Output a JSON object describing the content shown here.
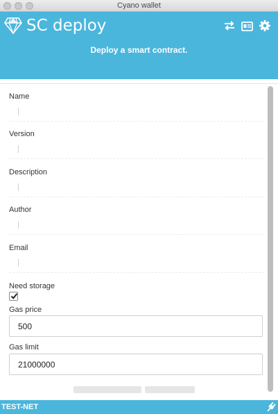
{
  "window": {
    "title": "Cyano wallet"
  },
  "header": {
    "app_title": "SC deploy",
    "subtitle": "Deploy a smart contract.",
    "icons": [
      "diamond-logo-icon",
      "swap-arrows-icon",
      "id-card-icon",
      "gear-icon"
    ]
  },
  "form": {
    "name_label": "Name",
    "name_value": "",
    "version_label": "Version",
    "version_value": "",
    "description_label": "Description",
    "description_value": "",
    "author_label": "Author",
    "author_value": "",
    "email_label": "Email",
    "email_value": "",
    "need_storage_label": "Need storage",
    "need_storage_checked": true,
    "gas_price_label": "Gas price",
    "gas_price_value": "500",
    "gas_limit_label": "Gas limit",
    "gas_limit_value": "21000000"
  },
  "footer": {
    "network": "TEST-NET",
    "icons": [
      "plug-icon"
    ]
  },
  "colors": {
    "accent": "#4ab6dc",
    "text": "#333333"
  }
}
